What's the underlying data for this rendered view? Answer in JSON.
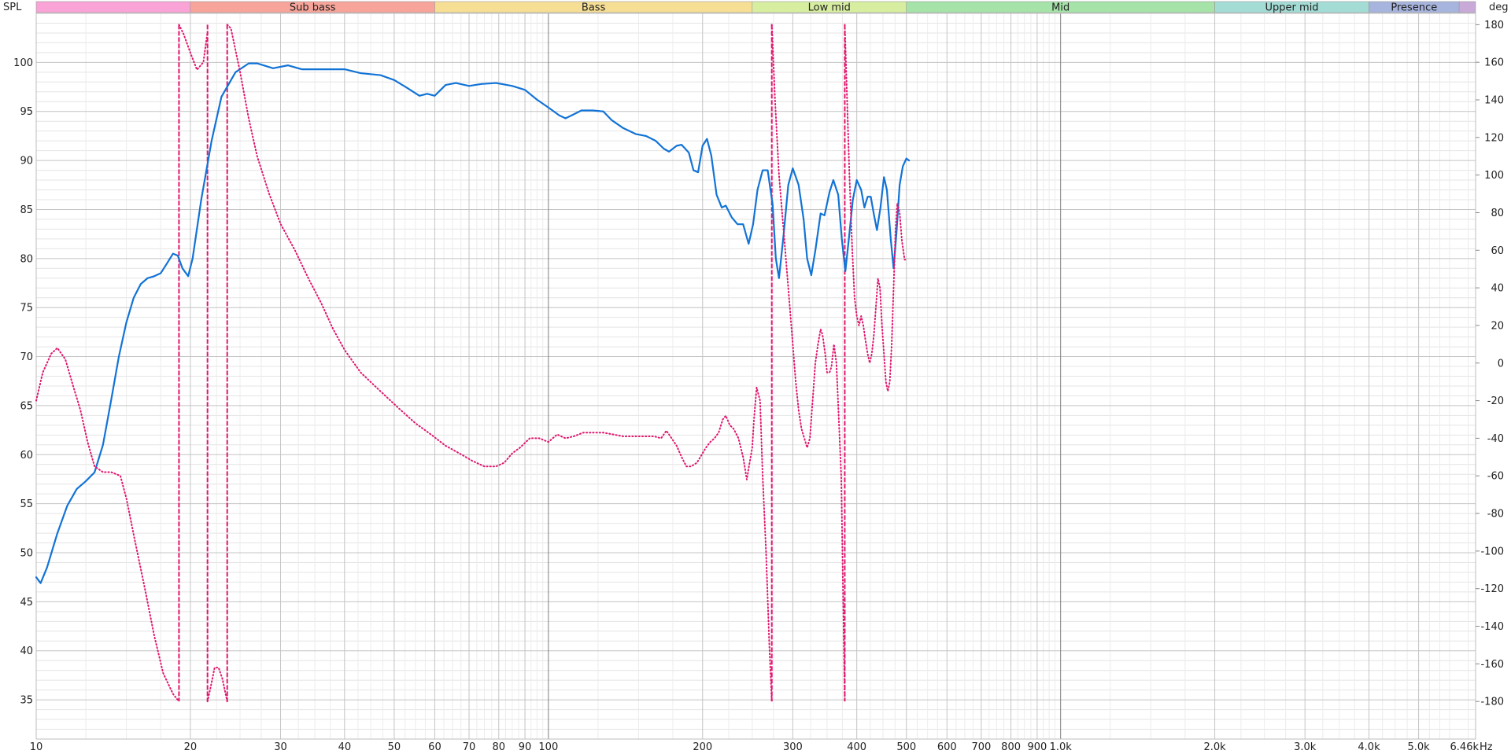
{
  "chart_data": {
    "type": "line",
    "x_scale": "log",
    "xlim": [
      10,
      6460
    ],
    "ylim": [
      31,
      105
    ],
    "y2lim": [
      -200,
      186
    ],
    "ylabel": "SPL",
    "y2label": "deg",
    "xunit": "Hz",
    "grid": true,
    "x_ticks": [
      {
        "value": 10,
        "label": "10"
      },
      {
        "value": 20,
        "label": "20"
      },
      {
        "value": 30,
        "label": "30"
      },
      {
        "value": 40,
        "label": "40"
      },
      {
        "value": 50,
        "label": "50"
      },
      {
        "value": 60,
        "label": "60"
      },
      {
        "value": 70,
        "label": "70"
      },
      {
        "value": 80,
        "label": "80"
      },
      {
        "value": 90,
        "label": "90"
      },
      {
        "value": 100,
        "label": "100"
      },
      {
        "value": 200,
        "label": "200"
      },
      {
        "value": 300,
        "label": "300"
      },
      {
        "value": 400,
        "label": "400"
      },
      {
        "value": 500,
        "label": "500"
      },
      {
        "value": 600,
        "label": "600"
      },
      {
        "value": 700,
        "label": "700"
      },
      {
        "value": 800,
        "label": "800"
      },
      {
        "value": 900,
        "label": "900"
      },
      {
        "value": 1000,
        "label": "1.0k"
      },
      {
        "value": 2000,
        "label": "2.0k"
      },
      {
        "value": 3000,
        "label": "3.0k"
      },
      {
        "value": 4000,
        "label": "4.0k"
      },
      {
        "value": 5000,
        "label": "5.0k"
      },
      {
        "value": 6460,
        "label": "6.46k"
      }
    ],
    "y_ticks": [
      "35",
      "40",
      "45",
      "50",
      "55",
      "60",
      "65",
      "70",
      "75",
      "80",
      "85",
      "90",
      "95",
      "100"
    ],
    "y2_ticks": [
      "-180",
      "-160",
      "-140",
      "-120",
      "-100",
      "-80",
      "-60",
      "-40",
      "-20",
      "0",
      "20",
      "40",
      "60",
      "80",
      "100",
      "120",
      "140",
      "160",
      "180"
    ],
    "bands": [
      {
        "label": "",
        "from": 10,
        "to": 20,
        "color": "#f9a3d6"
      },
      {
        "label": "Sub bass",
        "from": 20,
        "to": 60,
        "color": "#f7a49a"
      },
      {
        "label": "Bass",
        "from": 60,
        "to": 250,
        "color": "#f6de94"
      },
      {
        "label": "Low mid",
        "from": 250,
        "to": 500,
        "color": "#d7eea0"
      },
      {
        "label": "Mid",
        "from": 500,
        "to": 2000,
        "color": "#a5e3a8"
      },
      {
        "label": "Upper mid",
        "from": 2000,
        "to": 4000,
        "color": "#a3dcd5"
      },
      {
        "label": "Presence",
        "from": 4000,
        "to": 6000,
        "color": "#a7b4dd"
      },
      {
        "label": "",
        "from": 6000,
        "to": 6460,
        "color": "#c9a9d8"
      }
    ],
    "series": [
      {
        "name": "",
        "axis": "left",
        "color": "#1273d6",
        "style": "solid",
        "points": [
          [
            10,
            47.5
          ],
          [
            10.2,
            46.9
          ],
          [
            10.5,
            48.5
          ],
          [
            11,
            52
          ],
          [
            11.5,
            54.8
          ],
          [
            12,
            56.5
          ],
          [
            12.5,
            57.3
          ],
          [
            13,
            58.2
          ],
          [
            13.5,
            61
          ],
          [
            14,
            65.5
          ],
          [
            14.5,
            70
          ],
          [
            15,
            73.5
          ],
          [
            15.5,
            76
          ],
          [
            16,
            77.4
          ],
          [
            16.5,
            78
          ],
          [
            17,
            78.2
          ],
          [
            17.5,
            78.5
          ],
          [
            18,
            79.5
          ],
          [
            18.5,
            80.5
          ],
          [
            18.9,
            80.3
          ],
          [
            19.3,
            79
          ],
          [
            19.8,
            78.2
          ],
          [
            20.2,
            80
          ],
          [
            21,
            86
          ],
          [
            22,
            92
          ],
          [
            23,
            96.5
          ],
          [
            24.5,
            99
          ],
          [
            26,
            99.9
          ],
          [
            27,
            99.9
          ],
          [
            29,
            99.4
          ],
          [
            31,
            99.7
          ],
          [
            33,
            99.3
          ],
          [
            36,
            99.3
          ],
          [
            40,
            99.3
          ],
          [
            43,
            98.9
          ],
          [
            47,
            98.7
          ],
          [
            50,
            98.2
          ],
          [
            53,
            97.4
          ],
          [
            56,
            96.6
          ],
          [
            58,
            96.8
          ],
          [
            60,
            96.6
          ],
          [
            63,
            97.7
          ],
          [
            66,
            97.9
          ],
          [
            70,
            97.6
          ],
          [
            74,
            97.8
          ],
          [
            79,
            97.9
          ],
          [
            85,
            97.6
          ],
          [
            90,
            97.2
          ],
          [
            95,
            96.2
          ],
          [
            100,
            95.4
          ],
          [
            105,
            94.6
          ],
          [
            108,
            94.3
          ],
          [
            112,
            94.7
          ],
          [
            116,
            95.1
          ],
          [
            122,
            95.1
          ],
          [
            128,
            95.0
          ],
          [
            133,
            94.1
          ],
          [
            140,
            93.3
          ],
          [
            148,
            92.7
          ],
          [
            155,
            92.5
          ],
          [
            162,
            92.0
          ],
          [
            168,
            91.2
          ],
          [
            172,
            90.9
          ],
          [
            178,
            91.5
          ],
          [
            182,
            91.6
          ],
          [
            188,
            90.8
          ],
          [
            192,
            89.0
          ],
          [
            196,
            88.8
          ],
          [
            200,
            91.5
          ],
          [
            204,
            92.2
          ],
          [
            208,
            90.5
          ],
          [
            213,
            86.5
          ],
          [
            218,
            85.2
          ],
          [
            222,
            85.4
          ],
          [
            228,
            84.2
          ],
          [
            234,
            83.5
          ],
          [
            240,
            83.5
          ],
          [
            246,
            81.5
          ],
          [
            251,
            83.5
          ],
          [
            256,
            87
          ],
          [
            262,
            89
          ],
          [
            268,
            89
          ],
          [
            274,
            85.5
          ],
          [
            278,
            80
          ],
          [
            282,
            78
          ],
          [
            288,
            82.5
          ],
          [
            294,
            87.5
          ],
          [
            300,
            89.2
          ],
          [
            308,
            87.5
          ],
          [
            315,
            84
          ],
          [
            320,
            80
          ],
          [
            326,
            78.3
          ],
          [
            332,
            80.8
          ],
          [
            340,
            84.6
          ],
          [
            346,
            84.4
          ],
          [
            354,
            86.8
          ],
          [
            360,
            88
          ],
          [
            368,
            86.5
          ],
          [
            374,
            82
          ],
          [
            380,
            78.7
          ],
          [
            386,
            82
          ],
          [
            393,
            86
          ],
          [
            400,
            88
          ],
          [
            408,
            87
          ],
          [
            414,
            85.2
          ],
          [
            420,
            86.3
          ],
          [
            426,
            86.3
          ],
          [
            432,
            84.5
          ],
          [
            438,
            82.9
          ],
          [
            445,
            85.2
          ],
          [
            452,
            88.3
          ],
          [
            458,
            87
          ],
          [
            466,
            82
          ],
          [
            472,
            79
          ],
          [
            478,
            82.5
          ],
          [
            485,
            87.5
          ],
          [
            492,
            89.4
          ],
          [
            500,
            90.2
          ],
          [
            506,
            90.0
          ]
        ]
      },
      {
        "name": "",
        "axis": "right",
        "color": "#e0176f",
        "style": "dotted",
        "points": [
          [
            10,
            -20
          ],
          [
            10.3,
            -5
          ],
          [
            10.7,
            5
          ],
          [
            11,
            8
          ],
          [
            11.4,
            2
          ],
          [
            11.8,
            -12
          ],
          [
            12.2,
            -25
          ],
          [
            12.6,
            -42
          ],
          [
            13,
            -55
          ],
          [
            13.5,
            -58
          ],
          [
            14,
            -58
          ],
          [
            14.6,
            -60
          ],
          [
            15,
            -72
          ],
          [
            15.6,
            -95
          ],
          [
            16.3,
            -120
          ],
          [
            17,
            -145
          ],
          [
            17.7,
            -165
          ],
          [
            18.5,
            -176
          ],
          [
            19,
            -180
          ],
          null,
          [
            19,
            180
          ],
          [
            19.4,
            175
          ],
          [
            20,
            165
          ],
          [
            20.6,
            156
          ],
          [
            21.2,
            160
          ],
          [
            21.6,
            176
          ],
          null,
          [
            21.6,
            -180
          ],
          [
            22,
            -170
          ],
          [
            22.3,
            -162
          ],
          [
            22.7,
            -162
          ],
          [
            23.1,
            -168
          ],
          [
            23.6,
            -180
          ],
          null,
          [
            23.6,
            180
          ],
          [
            24,
            178
          ],
          [
            25,
            155
          ],
          [
            26,
            130
          ],
          [
            27,
            110
          ],
          [
            28.5,
            90
          ],
          [
            30,
            74
          ],
          [
            32,
            60
          ],
          [
            34,
            45
          ],
          [
            36,
            32
          ],
          [
            38,
            18
          ],
          [
            40,
            7
          ],
          [
            43,
            -5
          ],
          [
            47,
            -15
          ],
          [
            51,
            -24
          ],
          [
            55,
            -32
          ],
          [
            59,
            -38
          ],
          [
            63,
            -44
          ],
          [
            67,
            -48
          ],
          [
            71,
            -52
          ],
          [
            75,
            -55
          ],
          [
            79,
            -55
          ],
          [
            82,
            -53
          ],
          [
            85,
            -48
          ],
          [
            88,
            -45
          ],
          [
            92,
            -40
          ],
          [
            96,
            -40
          ],
          [
            100,
            -42
          ],
          [
            104,
            -38
          ],
          [
            108,
            -40
          ],
          [
            112,
            -39
          ],
          [
            117,
            -37
          ],
          [
            122,
            -37
          ],
          [
            128,
            -37
          ],
          [
            134,
            -38
          ],
          [
            140,
            -39
          ],
          [
            147,
            -39
          ],
          [
            154,
            -39
          ],
          [
            161,
            -39
          ],
          [
            166,
            -40
          ],
          [
            170,
            -36
          ],
          [
            174,
            -40
          ],
          [
            178,
            -44
          ],
          [
            182,
            -50
          ],
          [
            186,
            -55
          ],
          [
            190,
            -55
          ],
          [
            195,
            -53
          ],
          [
            199,
            -49
          ],
          [
            203,
            -45
          ],
          [
            207,
            -42
          ],
          [
            211,
            -40
          ],
          [
            215,
            -37
          ],
          [
            219,
            -30
          ],
          [
            222,
            -28
          ],
          [
            226,
            -33
          ],
          [
            230,
            -35
          ],
          [
            235,
            -40
          ],
          [
            240,
            -50
          ],
          [
            244,
            -62
          ],
          [
            246,
            -56
          ],
          [
            250,
            -45
          ],
          [
            252,
            -30
          ],
          [
            255,
            -13
          ],
          [
            259,
            -20
          ],
          [
            262,
            -60
          ],
          [
            266,
            -100
          ],
          [
            270,
            -150
          ],
          [
            273,
            -180
          ],
          null,
          [
            273,
            180
          ],
          [
            277,
            140
          ],
          [
            282,
            100
          ],
          [
            288,
            70
          ],
          [
            294,
            40
          ],
          [
            300,
            10
          ],
          [
            304,
            -10
          ],
          [
            308,
            -25
          ],
          [
            312,
            -35
          ],
          [
            316,
            -40
          ],
          [
            320,
            -45
          ],
          [
            324,
            -40
          ],
          [
            328,
            -20
          ],
          [
            332,
            0
          ],
          [
            336,
            10
          ],
          [
            340,
            18
          ],
          [
            343,
            15
          ],
          [
            347,
            5
          ],
          [
            350,
            -5
          ],
          [
            354,
            -5
          ],
          [
            357,
            -2
          ],
          [
            361,
            10
          ],
          [
            365,
            0
          ],
          [
            369,
            -30
          ],
          [
            373,
            -60
          ],
          [
            376,
            -120
          ],
          [
            379,
            -180
          ],
          null,
          [
            379,
            180
          ],
          [
            383,
            140
          ],
          [
            387,
            100
          ],
          [
            392,
            60
          ],
          [
            396,
            35
          ],
          [
            400,
            25
          ],
          [
            404,
            20
          ],
          [
            408,
            25
          ],
          [
            412,
            20
          ],
          [
            416,
            12
          ],
          [
            420,
            5
          ],
          [
            424,
            0
          ],
          [
            428,
            5
          ],
          [
            432,
            15
          ],
          [
            436,
            30
          ],
          [
            440,
            45
          ],
          [
            444,
            40
          ],
          [
            448,
            20
          ],
          [
            452,
            5
          ],
          [
            456,
            -10
          ],
          [
            460,
            -15
          ],
          [
            464,
            -10
          ],
          [
            468,
            10
          ],
          [
            472,
            40
          ],
          [
            476,
            70
          ],
          [
            480,
            85
          ],
          [
            485,
            80
          ],
          [
            490,
            65
          ],
          [
            496,
            55
          ],
          [
            502,
            55
          ]
        ]
      }
    ],
    "vlines": [
      {
        "x": 19,
        "color": "#e0176f"
      },
      {
        "x": 21.6,
        "color": "#e0176f"
      },
      {
        "x": 23.6,
        "color": "#e0176f"
      },
      {
        "x": 273,
        "color": "#e0176f"
      },
      {
        "x": 379,
        "color": "#e0176f"
      }
    ]
  }
}
